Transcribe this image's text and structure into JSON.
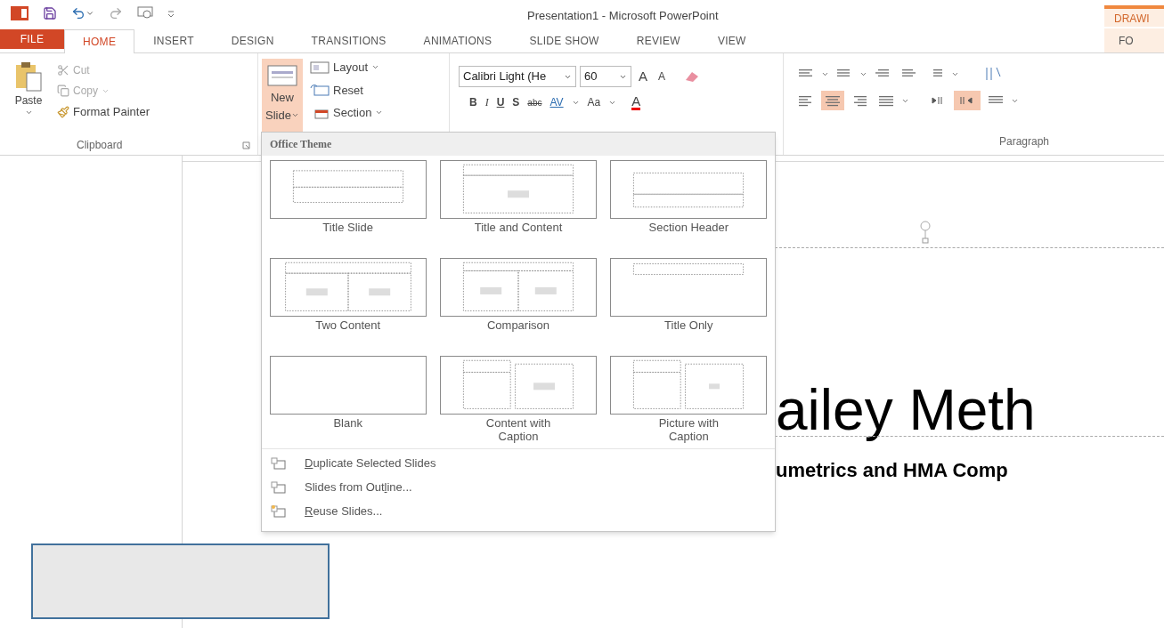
{
  "window": {
    "title": "Presentation1 - Microsoft PowerPoint"
  },
  "context_tab": {
    "group": "DRAWI",
    "tab": "FO"
  },
  "tabs": [
    {
      "label": "FILE",
      "kind": "file",
      "selected": false
    },
    {
      "label": "HOME",
      "kind": "tab",
      "selected": true
    },
    {
      "label": "INSERT",
      "kind": "tab",
      "selected": false
    },
    {
      "label": "DESIGN",
      "kind": "tab",
      "selected": false
    },
    {
      "label": "TRANSITIONS",
      "kind": "tab",
      "selected": false
    },
    {
      "label": "ANIMATIONS",
      "kind": "tab",
      "selected": false
    },
    {
      "label": "SLIDE SHOW",
      "kind": "tab",
      "selected": false
    },
    {
      "label": "REVIEW",
      "kind": "tab",
      "selected": false
    },
    {
      "label": "VIEW",
      "kind": "tab",
      "selected": false
    }
  ],
  "clipboard": {
    "paste": "Paste",
    "cut": "Cut",
    "copy": "Copy",
    "format_painter": "Format Painter",
    "label": "Clipboard"
  },
  "slides_group": {
    "new_slide_top": "New",
    "new_slide_bottom": "Slide",
    "new_slide_pressed": true,
    "layout": "Layout",
    "reset": "Reset",
    "section": "Section"
  },
  "font": {
    "name": "Calibri Light (He",
    "size": "60",
    "bold": "B",
    "italic": "I",
    "underline": "U",
    "shadow": "S",
    "strike": "abc",
    "spacing": "AV",
    "case": "Aa",
    "color_letter": "A",
    "grow": "A",
    "shrink": "A"
  },
  "paragraph": {
    "label": "Paragraph",
    "align": [
      {
        "kind": "left",
        "selected": false
      },
      {
        "kind": "center",
        "selected": true
      },
      {
        "kind": "right",
        "selected": false
      },
      {
        "kind": "justify",
        "selected": false
      }
    ],
    "direction": [
      {
        "kind": "ltr",
        "selected": false
      },
      {
        "kind": "rtl",
        "selected": true
      }
    ]
  },
  "menu": {
    "header": "Office Theme",
    "layouts": [
      {
        "name": "Title Slide",
        "kind": "title"
      },
      {
        "name": "Title and Content",
        "kind": "title_content"
      },
      {
        "name": "Section Header",
        "kind": "section"
      },
      {
        "name": "Two Content",
        "kind": "two_content"
      },
      {
        "name": "Comparison",
        "kind": "comparison"
      },
      {
        "name": "Title Only",
        "kind": "title_only"
      },
      {
        "name": "Blank",
        "kind": "blank"
      },
      {
        "name": "Content with Caption",
        "kind": "content_caption"
      },
      {
        "name": "Picture with Caption",
        "kind": "picture_caption"
      }
    ],
    "commands": [
      {
        "key": "D",
        "after": "uplicate Selected Slides",
        "kind": "duplicate"
      },
      {
        "before": "Slides from Out",
        "key": "l",
        "after": "ine...",
        "kind": "outline"
      },
      {
        "key": "R",
        "after": "euse Slides...",
        "kind": "reuse"
      }
    ]
  },
  "slide": {
    "title": "ailey Meth",
    "subtitle": "umetrics and HMA Comp"
  }
}
